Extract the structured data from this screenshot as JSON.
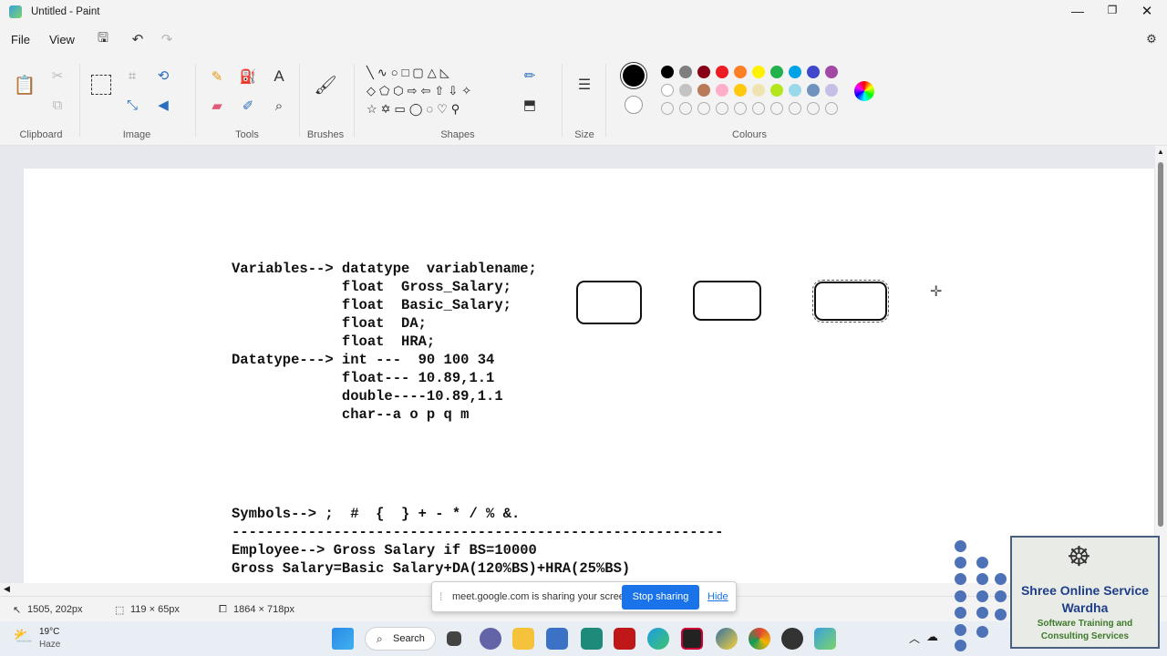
{
  "window": {
    "title": "Untitled - Paint"
  },
  "menu": {
    "file": "File",
    "view": "View"
  },
  "ribbon": {
    "groups": {
      "clipboard": "Clipboard",
      "image": "Image",
      "tools": "Tools",
      "brushes": "Brushes",
      "shapes": "Shapes",
      "size": "Size",
      "colours": "Colours"
    },
    "colours": {
      "row1": [
        "#000000",
        "#7f7f7f",
        "#880015",
        "#ed1c24",
        "#ff7f27",
        "#fff200",
        "#22b14c",
        "#00a2e8",
        "#3f48cc",
        "#a349a4"
      ],
      "row2": [
        "#ffffff",
        "#c3c3c3",
        "#b97a57",
        "#ffaec9",
        "#ffc90e",
        "#efe4b0",
        "#b5e61d",
        "#99d9ea",
        "#7092be",
        "#c8bfe7"
      ]
    }
  },
  "canvas": {
    "lines": [
      "Variables--> datatype  variablename;",
      "             float  Gross_Salary;",
      "             float  Basic_Salary;",
      "             float  DA;",
      "             float  HRA;",
      "Datatype---> int ---  90 100 34",
      "             float--- 10.89,1.1",
      "             double----10.89,1.1",
      "             char--a o p q m"
    ],
    "lines2": [
      "Symbols--> ;  #  {  } + - * / % &.",
      "----------------------------------------------------------",
      "Employee--> Gross Salary if BS=10000",
      "Gross Salary=Basic Salary+DA(120%BS)+HRA(25%BS)"
    ]
  },
  "status": {
    "cursor": "1505, 202px",
    "selection": "119 × 65px",
    "canvas_size": "1864 × 718px"
  },
  "share": {
    "text": "meet.google.com is sharing your screen.",
    "stop": "Stop sharing",
    "hide": "Hide"
  },
  "taskbar": {
    "temp": "19°C",
    "weather": "Haze",
    "search": "Search"
  },
  "logo": {
    "line1": "Shree Online Service",
    "line2": "Wardha",
    "line3": "Software Training and",
    "line4": "Consulting Services"
  }
}
